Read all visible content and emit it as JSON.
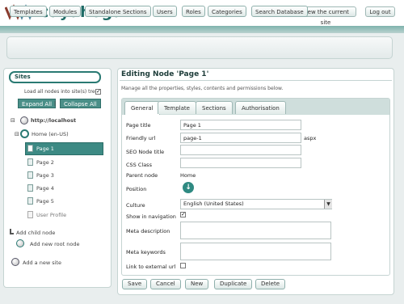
{
  "app": {
    "logo_text": "cuyahoga"
  },
  "header": {
    "view_site_label": "View the current site",
    "logout_label": "Log out"
  },
  "nav": {
    "items": [
      "Templates",
      "Modules",
      "Standalone Sections",
      "Users",
      "Roles",
      "Categories",
      "Search Database"
    ]
  },
  "sidebar": {
    "sites_title": "Sites",
    "load_all_label": "Load all nodes into site(s) tree",
    "load_all_checked": true,
    "expand_all_label": "Expand All",
    "separator": "|",
    "collapse_all_label": "Collapse All",
    "site_url": "http://localhost",
    "root_node": "Home (en-US)",
    "pages": [
      "Page 1",
      "Page 2",
      "Page 3",
      "Page 4",
      "Page 5",
      "User Profile"
    ],
    "selected_page": "Page 1",
    "add_child_label": "Add child node",
    "add_root_label": "Add new root node",
    "add_site_label": "Add a new site"
  },
  "main": {
    "title": "Editing Node 'Page 1'",
    "subtitle": "Manage all the properties, styles, contents and permissions below.",
    "tabs": [
      "General",
      "Template",
      "Sections",
      "Authorisation"
    ],
    "active_tab": "General",
    "form": {
      "page_title_label": "Page title",
      "page_title_value": "Page 1",
      "friendly_url_label": "Friendly url",
      "friendly_url_value": "page-1",
      "friendly_url_suffix": "aspx",
      "seo_title_label": "SEO Node title",
      "seo_title_value": "",
      "css_class_label": "CSS Class",
      "css_class_value": "",
      "parent_node_label": "Parent node",
      "parent_node_value": "Home",
      "position_label": "Position",
      "culture_label": "Culture",
      "culture_value": "English (United States)",
      "show_nav_label": "Show in navigation",
      "show_nav_checked": true,
      "meta_desc_label": "Meta description",
      "meta_desc_value": "",
      "meta_keywords_label": "Meta keywords",
      "meta_keywords_value": "",
      "link_external_label": "Link to external url",
      "link_external_checked": false
    },
    "buttons": {
      "save": "Save",
      "cancel": "Cancel",
      "new": "New",
      "duplicate": "Duplicate",
      "delete": "Delete"
    }
  },
  "colors": {
    "brand": "#1e6b66",
    "selected_bg": "#3d8a84",
    "accent_band": "#9fc3bf"
  },
  "icons": [
    "logo-wave-icon",
    "globe-icon",
    "page-icon",
    "move-down-icon",
    "dropdown-arrow-icon",
    "add-child-icon",
    "add-root-icon",
    "add-site-icon"
  ]
}
